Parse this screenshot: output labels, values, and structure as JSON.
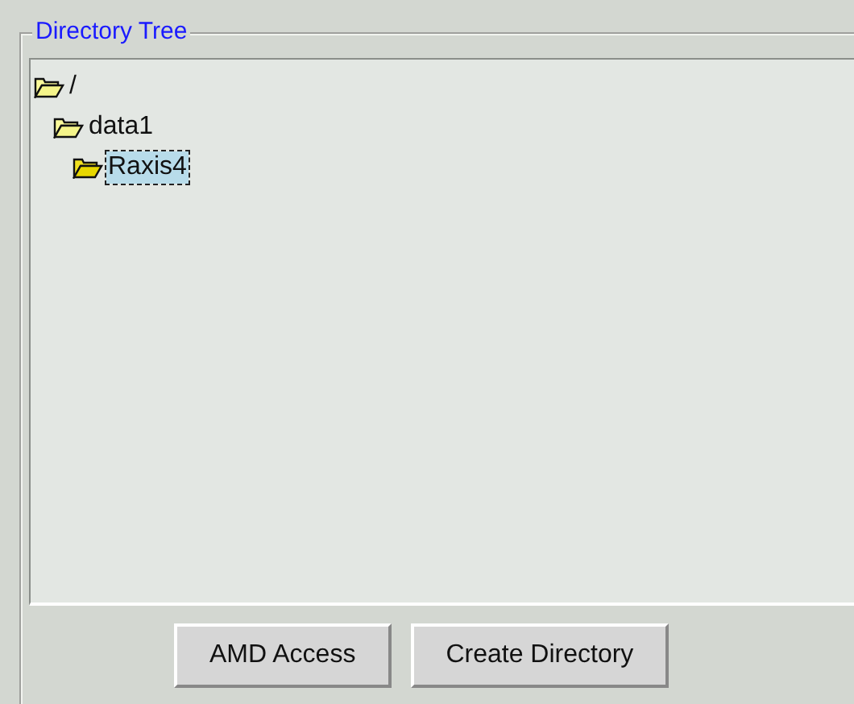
{
  "panel": {
    "title": "Directory Tree"
  },
  "tree": [
    {
      "label": "/",
      "selected": false,
      "children": [
        {
          "label": "data1",
          "selected": false,
          "children": [
            {
              "label": "Raxis4",
              "selected": true
            }
          ]
        }
      ]
    }
  ],
  "buttons": [
    {
      "label": "AMD Access"
    },
    {
      "label": "Create Directory"
    }
  ]
}
